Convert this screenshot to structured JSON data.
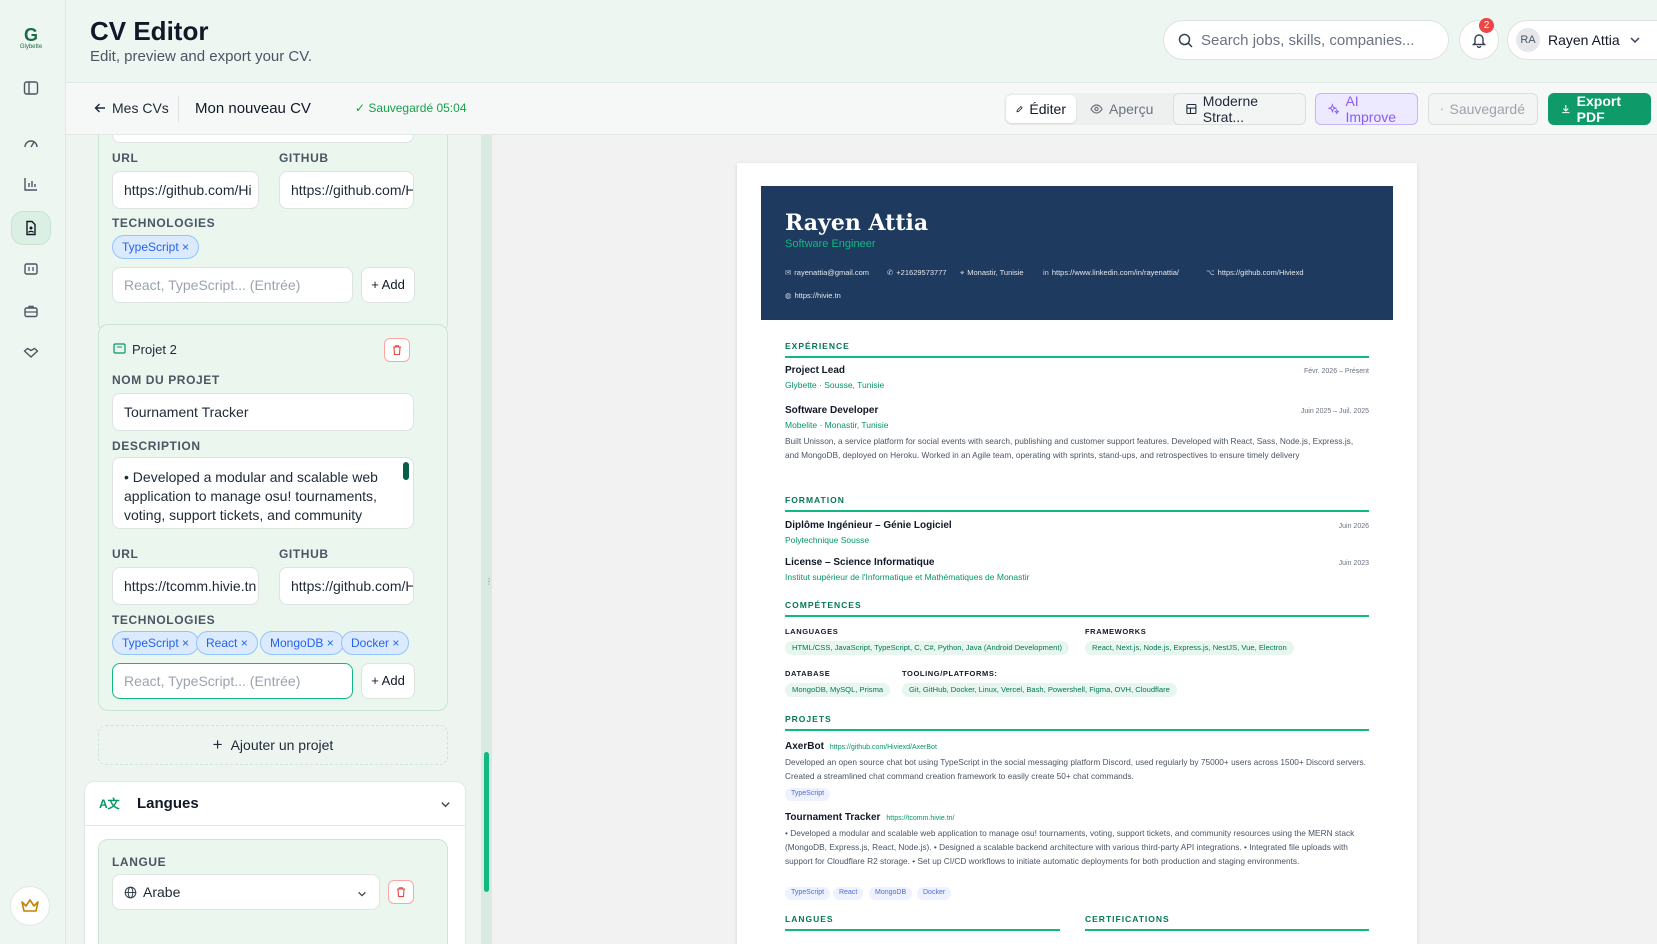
{
  "app": {
    "logo_text": "Glybette"
  },
  "header": {
    "title": "CV Editor",
    "subtitle": "Edit, preview and export your CV.",
    "search_placeholder": "Search jobs, skills, companies...",
    "notification_count": "2",
    "user": {
      "initials": "RA",
      "name": "Rayen Attia"
    }
  },
  "toolbar": {
    "back_label": "Mes CVs",
    "cv_name": "Mon nouveau CV",
    "saved_status": "Sauvegardé 05:04",
    "edit_label": "Éditer",
    "preview_label": "Aperçu",
    "template_label": "Moderne Strat...",
    "ai_label": "AI Improve",
    "save_label": "Sauvegardé",
    "export_label": "Export PDF"
  },
  "editor": {
    "project1": {
      "url_label": "URL",
      "github_label": "GITHUB",
      "url_value": "https://github.com/Hi",
      "github_value": "https://github.com/Hi",
      "tech_label": "TECHNOLOGIES",
      "techs": [
        "TypeScript"
      ],
      "tech_placeholder": "React, TypeScript... (Entrée)",
      "add_label": "+ Add"
    },
    "project2": {
      "heading": "Projet 2",
      "name_label": "NOM DU PROJET",
      "name_value": "Tournament Tracker",
      "desc_label": "DESCRIPTION",
      "desc_value": "• Developed a modular and scalable web application to manage osu! tournaments, voting, support tickets, and community resources using the MERN",
      "url_label": "URL",
      "github_label": "GITHUB",
      "url_value": "https://tcomm.hivie.tn",
      "github_value": "https://github.com/Hi",
      "tech_label": "TECHNOLOGIES",
      "techs": [
        "TypeScript",
        "React",
        "MongoDB",
        "Docker"
      ],
      "tech_placeholder": "React, TypeScript... (Entrée)",
      "add_label": "+ Add"
    },
    "add_project_label": "Ajouter un projet",
    "languages_section": "Langues",
    "language_label": "LANGUE",
    "language_value": "Arabe"
  },
  "cv": {
    "name": "Rayen Attia",
    "role": "Software Engineer",
    "contacts": {
      "email": "rayenattia@gmail.com",
      "phone": "+21629573777",
      "location": "Monastir, Tunisie",
      "linkedin": "https://www.linkedin.com/in/rayenattia/",
      "github": "https://github.com/Hiviexd",
      "website": "https://hivie.tn"
    },
    "experience_title": "EXPÉRIENCE",
    "experience": [
      {
        "title": "Project Lead",
        "org": "Glybette · Sousse, Tunisie",
        "date": "Févr. 2026 – Présent"
      },
      {
        "title": "Software Developer",
        "org": "Mobelite · Monastir, Tunisie",
        "date": "Juin 2025 – Juil. 2025",
        "desc": "Built Unisson, a service platform for social events with search, publishing and customer support features. Developed with React, Sass, Node.js, Express.js, and MongoDB, deployed on Heroku. Worked in an Agile team, operating with sprints, stand-ups, and retrospectives to ensure timely delivery"
      }
    ],
    "education_title": "FORMATION",
    "education": [
      {
        "title": "Diplôme Ingénieur – Génie Logiciel",
        "org": "Polytechnique Sousse",
        "date": "Juin 2026"
      },
      {
        "title": "License – Science Informatique",
        "org": "Institut supérieur de l'Informatique et Mathématiques de Monastir",
        "date": "Juin 2023"
      }
    ],
    "skills_title": "COMPÉTENCES",
    "skills": {
      "languages_label": "LANGUAGES",
      "languages": "HTML/CSS, JavaScript, TypeScript, C, C#, Python, Java (Android Development)",
      "frameworks_label": "FRAMEWORKS",
      "frameworks": "React, Next.js, Node.js, Express.js, NestJS, Vue, Electron",
      "database_label": "DATABASE",
      "database": "MongoDB, MySQL, Prisma",
      "tooling_label": "TOOLING/PLATFORMS:",
      "tooling": "Git, GitHub, Docker, Linux, Vercel, Bash, Powershell, Figma, OVH, Cloudflare"
    },
    "projects_title": "PROJETS",
    "projects": [
      {
        "name": "AxerBot",
        "link": "https://github.com/Hiviexd/AxerBot",
        "desc": "Developed an open source chat bot using TypeScript in the social messaging platform Discord, used regularly by 75000+ users across 1500+ Discord servers. Created a streamlined chat command creation framework to easily create 50+ chat commands.",
        "techs": [
          "TypeScript"
        ]
      },
      {
        "name": "Tournament Tracker",
        "link": "https://tcomm.hivie.tn/",
        "desc": "• Developed a modular and scalable web application to manage osu! tournaments, voting, support tickets, and community resources using the MERN stack (MongoDB, Express.js, React, Node.js). • Designed a scalable backend architecture with various third-party API integrations. • Integrated file uploads with support for Cloudflare R2 storage. • Set up CI/CD workflows to initiate automatic deployments for both production and staging environments.",
        "techs": [
          "TypeScript",
          "React",
          "MongoDB",
          "Docker"
        ]
      }
    ],
    "languages_title": "LANGUES",
    "certifications_title": "CERTIFICATIONS"
  },
  "colors": {
    "accent": "#10b981",
    "cv_header": "#1e3a5f",
    "export": "#0f9a6a"
  }
}
